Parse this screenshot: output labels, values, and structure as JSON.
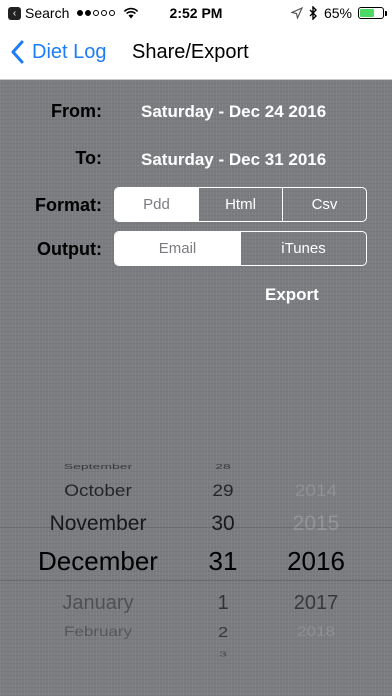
{
  "status_bar": {
    "back_label": "Search",
    "time": "2:52 PM",
    "battery": "65%",
    "battery_level": 0.65,
    "signal_bars_filled": 2,
    "signal_bars_total": 5
  },
  "nav": {
    "back_label": "Diet Log",
    "title": "Share/Export"
  },
  "form": {
    "from_label": "From:",
    "from_value": "Saturday - Dec 24 2016",
    "to_label": "To:",
    "to_value": "Saturday - Dec 31 2016",
    "format_label": "Format:",
    "format_options": [
      "Pdd",
      "Html",
      "Csv"
    ],
    "format_selected": "Pdd",
    "output_label": "Output:",
    "output_options": [
      "Email",
      "iTunes"
    ],
    "output_selected": "Email",
    "export_label": "Export"
  },
  "picker": {
    "months": [
      "September",
      "October",
      "November",
      "December",
      "January",
      "February"
    ],
    "days": [
      "28",
      "29",
      "30",
      "31",
      "1",
      "2",
      "3"
    ],
    "years": [
      "2014",
      "2015",
      "2016",
      "2017",
      "2018"
    ],
    "selected_month": "December",
    "selected_day": "31",
    "selected_year": "2016"
  },
  "colors": {
    "accent": "#1e7df6",
    "background_texture": "#7a7c80",
    "battery_green": "#4cd964"
  }
}
